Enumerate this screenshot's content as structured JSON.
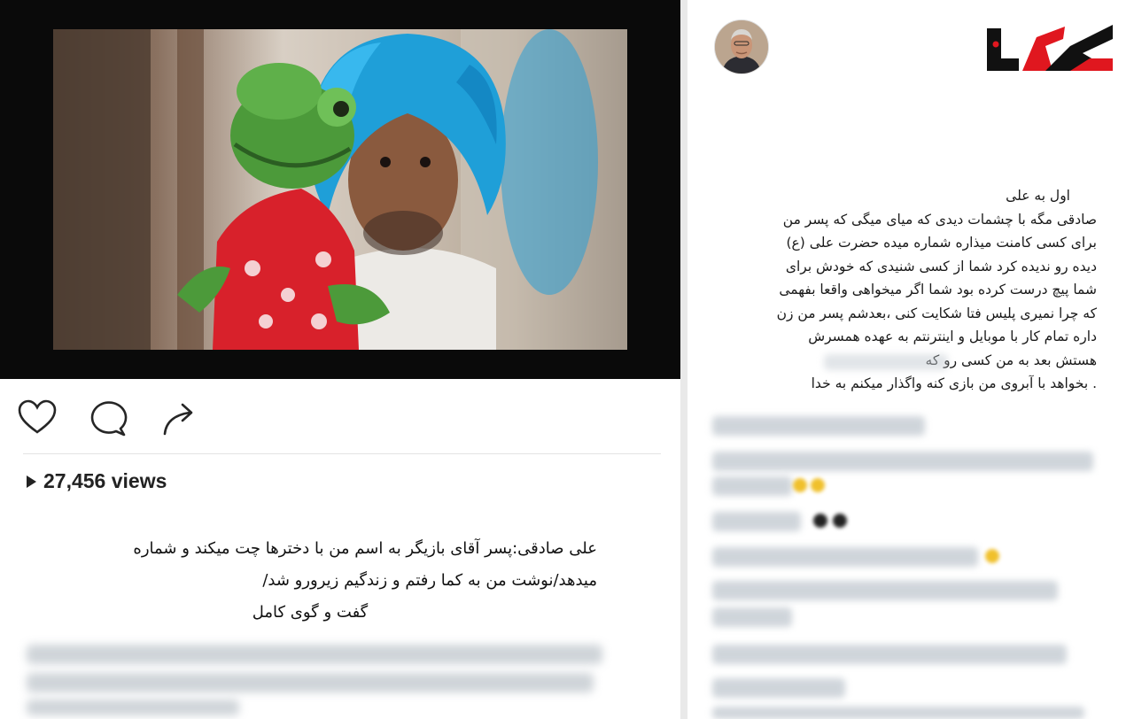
{
  "post": {
    "views_count": "27,456 views",
    "caption_lines": [
      "علی صادقی:پسر آقای بازیگر به اسم من با دخترها چت میکند و شماره",
      "میدهد/نوشت من به کما رفتم و زندگیم زیرورو شد/",
      "گفت و گوی کامل"
    ]
  },
  "actions": {
    "like_icon": "heart-outline-icon",
    "comment_icon": "speech-bubble-icon",
    "share_icon": "share-arrow-icon"
  },
  "sidebar": {
    "avatar_icon": "profile-avatar",
    "logo_icon": "rokna-logo",
    "caption_title": "اول به علی",
    "caption_lines": [
      "صادقی مگه با چشمات دیدی که میای میگی که پسر من",
      "برای کسی کامنت میذاره شماره میده حضرت علی (ع)",
      "دیده رو ندیده کرد شما از کسی شنیدی که خودش برای",
      "شما پیچ درست کرده بود شما اگر میخواهی واقعا بفهمی",
      "که چرا نمیری پلیس فتا شکایت کنی ،بعدشم پسر من زن",
      "داره تمام کار با موبایل و اینترنتم به عهده همسرش",
      "هستش بعد به        من کسی رو که",
      ". بخواهد با آبروی من بازی کنه واگذار میکنم به خدا"
    ]
  },
  "colors": {
    "frame": "#0a0a0a",
    "wig_blue": "#1f9fd8",
    "puppet_green": "#4c9a3a",
    "puppet_red": "#d8212b",
    "logo_red": "#e0171f",
    "logo_black": "#111111"
  }
}
